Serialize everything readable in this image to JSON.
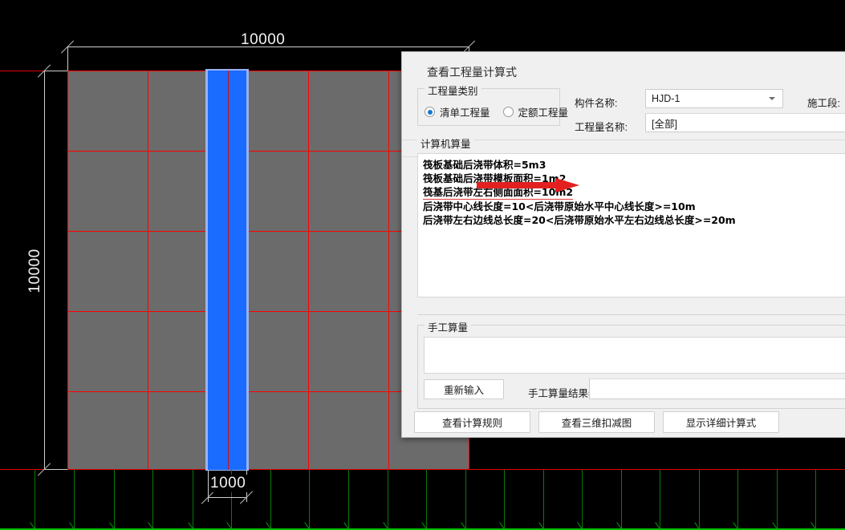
{
  "cad": {
    "dim_top": "10000",
    "dim_left": "10000",
    "dim_bottom": "1000",
    "colors": {
      "background": "#000000",
      "slab_fill": "#6b6b6b",
      "gridline": "#ff0000",
      "strip_fill": "#1a6bff",
      "strip_halo": "#9ab2f0",
      "axis_green": "#00c000",
      "dimension": "#cfcfcf"
    }
  },
  "dialog": {
    "title": "查看工程量计算式",
    "category_group": {
      "legend": "工程量类别",
      "options": [
        {
          "label": "清单工程量",
          "selected": true
        },
        {
          "label": "定额工程量",
          "selected": false
        }
      ]
    },
    "fields": {
      "component_label": "构件名称:",
      "component_value": "HJD-1",
      "quantity_label": "工程量名称:",
      "quantity_value": "[全部]",
      "section_label": "施工段:"
    },
    "computed_group": {
      "legend": "计算机算量",
      "lines": [
        "筏板基础后浇带体积=5m3",
        "筏板基础后浇带模板面积=1m2",
        "筏基后浇带左右侧面面积=10m2",
        "后浇带中心线长度=10<后浇带原始水平中心线长度>=10m",
        "后浇带左右边线总长度=20<后浇带原始水平左右边线总长度>=20m"
      ],
      "underlined_line_index": 2,
      "annotation_arrow_color": "#e32020"
    },
    "manual_group": {
      "legend": "手工算量",
      "input_value": "",
      "reinput_button": "重新输入",
      "result_label": "手工算量结果=",
      "result_value": ""
    },
    "footer_buttons": [
      "查看计算规则",
      "查看三维扣减图",
      "显示详细计算式"
    ]
  }
}
